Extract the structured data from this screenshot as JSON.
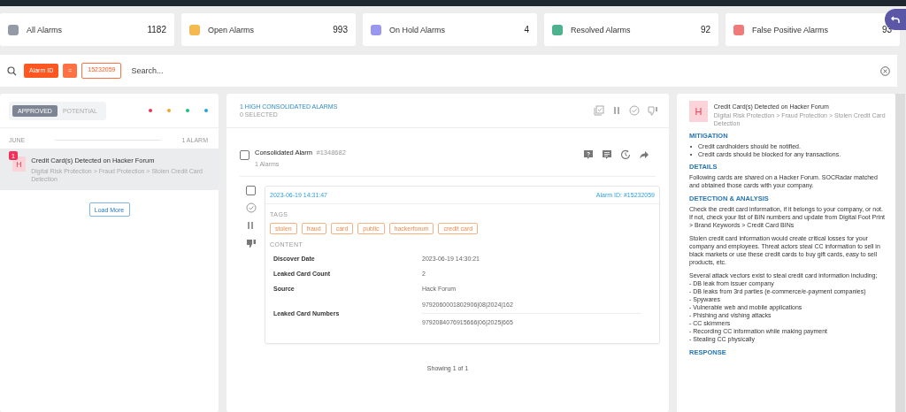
{
  "stats": [
    {
      "label": "All Alarms",
      "count": "1182",
      "color": "#959ba6"
    },
    {
      "label": "Open Alarms",
      "count": "993",
      "color": "#f5b94f"
    },
    {
      "label": "On Hold Alarms",
      "count": "4",
      "color": "#9a97f0"
    },
    {
      "label": "Resolved Alarms",
      "count": "92",
      "color": "#4cb38e"
    },
    {
      "label": "False Positive Alarms",
      "count": "93",
      "color": "#f07a7a"
    }
  ],
  "search": {
    "chips": [
      {
        "kind": "field",
        "text": "Alarm ID"
      },
      {
        "kind": "operator",
        "text": "="
      },
      {
        "kind": "value",
        "text": "15232059"
      }
    ],
    "placeholder": "Search..."
  },
  "left": {
    "tabs": [
      {
        "label": "APPROVED",
        "selected": true
      },
      {
        "label": "POTENTIAL",
        "selected": false
      }
    ],
    "dots": [
      {
        "color": "#f0325a"
      },
      {
        "color": "#f5a623"
      },
      {
        "color": "#1bbf7a"
      },
      {
        "color": "#1aa3e8"
      }
    ],
    "group": {
      "month": "JUNE",
      "count": "1 ALARM"
    },
    "items": [
      {
        "badge": "1",
        "avatar": "H",
        "title": "Credit Card(s) Detected on Hacker Forum",
        "path": "Digital Risk Protection > Fraud Protection > Stolen Credit Card Detection",
        "selected": true
      }
    ],
    "load_more": "Load More"
  },
  "middle": {
    "title": "1 HIGH CONSOLIDATED ALARMS",
    "selected_count": "0 SELECTED",
    "alarm": {
      "title": "Consolidated Alarm",
      "id": "#1348682",
      "count": "1 Alarms",
      "checked": false,
      "date": "2023-06-19 14:31:47",
      "alarm_id": "Alarm ID: #15232059",
      "checked_detail": false,
      "tags_label": "TAGS",
      "tags": [
        "stolen",
        "fraud",
        "card",
        "public",
        "hackerforum",
        "credit card"
      ],
      "content_label": "CONTENT",
      "fields": [
        {
          "label": "Discover Date",
          "values": [
            "2023-06-19 14:30:21"
          ]
        },
        {
          "label": "Leaked Card Count",
          "values": [
            "2"
          ]
        },
        {
          "label": "Source",
          "values": [
            "Hack Forum"
          ]
        },
        {
          "label": "Leaked Card Numbers",
          "values": [
            "9792060001802906|08|2024|162",
            "9792084076915666|06|2025|665"
          ]
        }
      ]
    },
    "footer": "Showing 1 of 1"
  },
  "right": {
    "avatar": "H",
    "title": "Credit Card(s) Detected on Hacker Forum",
    "path": "Digital Risk Protection > Fraud Protection > Stolen Credit Card Detection",
    "sections": [
      {
        "heading": "MITIGATION",
        "kind": "bullets",
        "items": [
          "Credit cardholders should be notified.",
          "Credit cards should be blocked for any transactions."
        ]
      },
      {
        "heading": "DETAILS",
        "kind": "text",
        "paragraphs": [
          [
            "Following cards are shared on a Hacker Forum. SOCRadar matched and obtained those cards with your company."
          ]
        ]
      },
      {
        "heading": "DETECTION & ANALYSIS",
        "kind": "text",
        "paragraphs": [
          [
            "Check the credit card information, if it belongs to your company, or not. If not, check your list of BIN numbers and update from Digital Foot Print > Brand Keywords > Credit Card BINs"
          ],
          [
            "Stolen credit card information would create critical losses for your company and employees. Threat actors steal CC information to sell in black markets or use these credit cards to buy gift cards, easy to sell products, etc."
          ],
          [
            "Several attack vectors exist to steal credit card information including;",
            "- DB leak from issuer company",
            "- DB leaks from 3rd parties (e-commerce/e-payment companies)",
            "- Spywares",
            "- Vulnerable web and mobile applications",
            "- Phishing and vishing attacks",
            "- CC skimmers",
            "- Recording CC information while making payment",
            "- Stealing CC physically"
          ]
        ]
      },
      {
        "heading": "RESPONSE",
        "kind": "text"
      }
    ]
  }
}
